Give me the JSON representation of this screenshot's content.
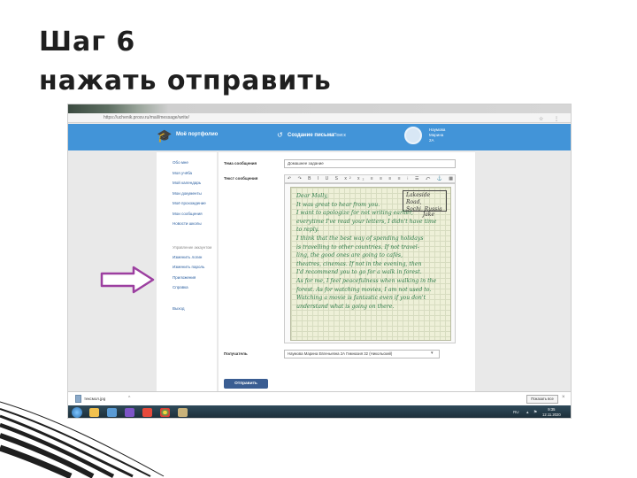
{
  "slide": {
    "title_line1": "Шаг 6",
    "title_line2": "нажать отправить"
  },
  "browser": {
    "url": "https://uchenik.prosv.ru/mail/message/write/"
  },
  "header": {
    "brand": "Моё портфолио",
    "new_message": "Создание письма",
    "search": "Поиск",
    "user_line1": "Наумова",
    "user_line2": "Марина",
    "user_line3": "2А"
  },
  "sidebar": {
    "items": [
      "Обо мне",
      "Моя учёба",
      "Мой календарь",
      "Мои документы",
      "Моё прохождение",
      "Мои сообщения",
      "Новости школы"
    ],
    "section_label": "Управление аккаунтом",
    "account_items": [
      "Изменить логин",
      "Изменить пароль",
      "Приложения",
      "Справка"
    ],
    "logout": "Выход"
  },
  "form": {
    "subject_label": "Тема сообщения",
    "subject_value": "Домашнее задание",
    "text_label": "Текст сообщения",
    "toolbar": "↶ ↷ B I U S x² x₂ ≡ ≡ ≡ ≡ ⁝ ☰ ⤺ ⚓ ▦ Ω ⊞",
    "recipient_label": "Получатель",
    "recipient_value": "Наумова Марина Евгеньевна 2А Гимназия 32 (Никольский)",
    "send_button": "Отправить"
  },
  "letter": {
    "address_line1": "Lakeside Road,",
    "address_line2": "Sochi, Russia",
    "signature_name": "Jake",
    "lines": [
      "Dear Molly,",
      "It was great to hear from you.",
      "I want to apologize for not writing earlier,",
      "everytime I've read your letters, I didn't have time",
      "to reply.",
      "   I think that the best way of spending holidays",
      "is travelling to other countries. If not travel-",
      "ling, the good ones are going to cafés,",
      "theatres, cinemas. If not in the evening, then",
      "I'd recommend you to go for a walk in forest.",
      "As for me, I feel peacefulness when walking in the",
      "forest. As for watching movies, I am not used to.",
      "Watching a movie is fantastic even if you don't",
      "understand what is going on there."
    ]
  },
  "downloads": {
    "file_name": "тексмол.jpg",
    "show_all": "Показать все"
  },
  "taskbar": {
    "language": "RU",
    "time": "9:35",
    "date": "12.11.2020"
  },
  "colors": {
    "header_blue": "#4294d8",
    "send_button": "#3a5d92",
    "arrow": "#9c3fa0",
    "handwriting": "#2f7d4a"
  }
}
